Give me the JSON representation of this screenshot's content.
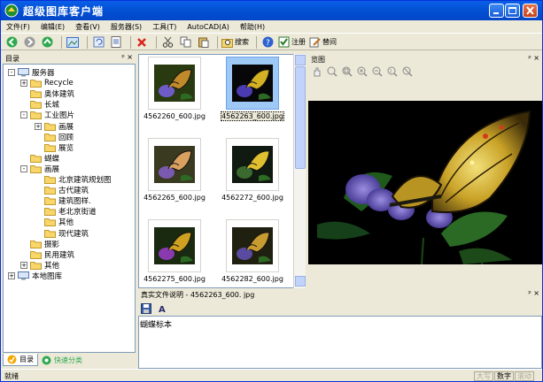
{
  "window": {
    "title": "超级图库客户端"
  },
  "menu": [
    "文件(F)",
    "编辑(E)",
    "查看(V)",
    "服务器(S)",
    "工具(T)",
    "AutoCAD(A)",
    "帮助(H)"
  ],
  "toolbar": {
    "search_label": "搜索",
    "register_label": "注册",
    "rename_label": "替间"
  },
  "tree_panel": {
    "title": "目录",
    "pin": "ᵖ ×"
  },
  "tree": [
    {
      "label": "服务器",
      "level": 0,
      "toggle": "-"
    },
    {
      "label": "Recycle",
      "level": 1,
      "toggle": "+"
    },
    {
      "label": "奥体建筑",
      "level": 1,
      "toggle": ""
    },
    {
      "label": "长城",
      "level": 1,
      "toggle": ""
    },
    {
      "label": "工业图片",
      "level": 1,
      "toggle": "-"
    },
    {
      "label": "画展",
      "level": 2,
      "toggle": "+"
    },
    {
      "label": "回顾",
      "level": 2,
      "toggle": ""
    },
    {
      "label": "展览",
      "level": 2,
      "toggle": ""
    },
    {
      "label": "蝴蝶",
      "level": 1,
      "toggle": ""
    },
    {
      "label": "画展",
      "level": 1,
      "toggle": "-"
    },
    {
      "label": "北京建筑规划图",
      "level": 2,
      "toggle": ""
    },
    {
      "label": "古代建筑",
      "level": 2,
      "toggle": ""
    },
    {
      "label": "建筑图样.",
      "level": 2,
      "toggle": ""
    },
    {
      "label": "老北京街道",
      "level": 2,
      "toggle": ""
    },
    {
      "label": "其他",
      "level": 2,
      "toggle": ""
    },
    {
      "label": "现代建筑",
      "level": 2,
      "toggle": ""
    },
    {
      "label": "摄影",
      "level": 1,
      "toggle": ""
    },
    {
      "label": "民用建筑",
      "level": 1,
      "toggle": ""
    },
    {
      "label": "其他",
      "level": 1,
      "toggle": "+"
    },
    {
      "label": "本地图库",
      "level": 0,
      "toggle": "+"
    }
  ],
  "bottom_tabs": [
    {
      "label": "目录",
      "active": true
    },
    {
      "label": "快速分类",
      "active": false
    }
  ],
  "thumbnails": [
    {
      "file": "4562260_600.jpg",
      "selected": false
    },
    {
      "file": "4562263_600.jpg",
      "selected": true
    },
    {
      "file": "4562265_600.jpg",
      "selected": false
    },
    {
      "file": "4562272_600.jpg",
      "selected": false
    },
    {
      "file": "4562275_600.jpg",
      "selected": false
    },
    {
      "file": "4562282_600.jpg",
      "selected": false
    }
  ],
  "preview": {
    "title": "览图",
    "pin": "ᵖ ×"
  },
  "description": {
    "title": "真实文件说明 - 4562263_600. jpg",
    "text": "蝴蝶标本",
    "pin": "ᵖ ×"
  },
  "status": {
    "text": "就绪",
    "cells": [
      "大写",
      "数字",
      "滚动"
    ]
  }
}
